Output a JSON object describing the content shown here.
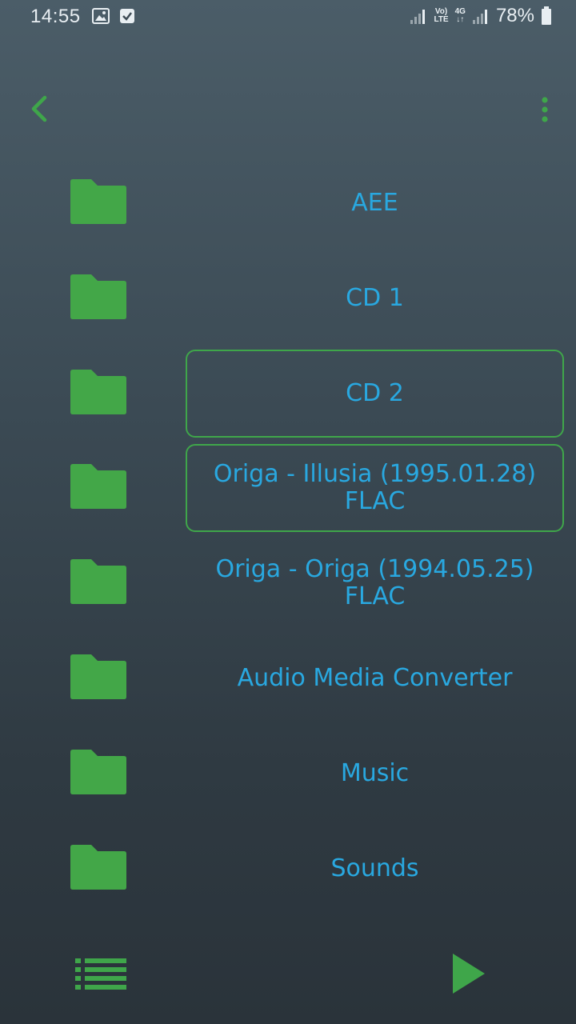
{
  "status_bar": {
    "time": "14:55",
    "battery": "78%",
    "network_top": "Vo)",
    "network_bottom": "LTE",
    "data_type": "4G"
  },
  "colors": {
    "accent_green": "#3fa64a",
    "label_blue": "#29a8e0"
  },
  "folders": [
    {
      "label": "AEE",
      "selected": false
    },
    {
      "label": "CD 1",
      "selected": false
    },
    {
      "label": "CD 2",
      "selected": true
    },
    {
      "label": "Origa - Illusia (1995.01.28) FLAC",
      "selected": true
    },
    {
      "label": "Origa - Origa (1994.05.25) FLAC",
      "selected": false
    },
    {
      "label": "Audio Media Converter",
      "selected": false
    },
    {
      "label": "Music",
      "selected": false
    },
    {
      "label": "Sounds",
      "selected": false
    }
  ],
  "icons": {
    "back": "chevron-left-icon",
    "menu": "more-vertical-icon",
    "folder": "folder-icon",
    "list_view": "list-icon",
    "play": "play-icon"
  }
}
